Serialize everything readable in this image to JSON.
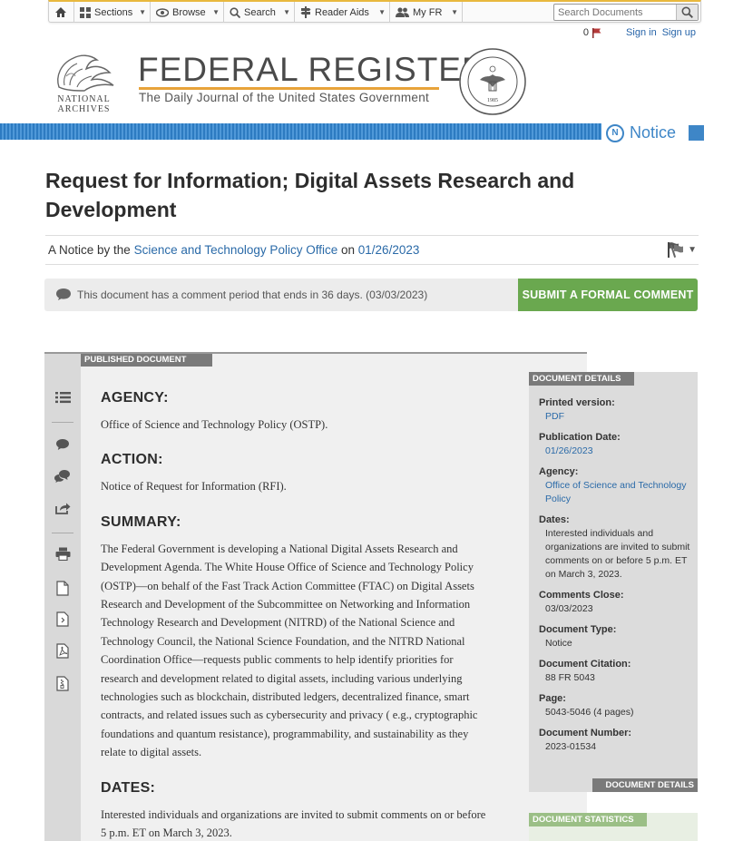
{
  "nav": {
    "home_label": "",
    "items": [
      {
        "label": "Sections"
      },
      {
        "label": "Browse"
      },
      {
        "label": "Search"
      },
      {
        "label": "Reader Aids"
      },
      {
        "label": "My FR"
      }
    ],
    "search_placeholder": "Search Documents"
  },
  "user": {
    "flag_count": "0",
    "sign_in": "Sign in",
    "sign_up": "Sign up"
  },
  "masthead": {
    "agency_logo_text_1": "NATIONAL",
    "agency_logo_text_2": "ARCHIVES",
    "title": "FEDERAL REGISTER",
    "subtitle": "The Daily Journal of the United States Government",
    "seal_text": "NATIONAL ARCHIVES AND RECORDS ADMINISTRATION",
    "seal_year": "1985"
  },
  "document_type_badge": {
    "letter": "N",
    "label": "Notice"
  },
  "document": {
    "title": "Request for Information; Digital Assets Research and Development",
    "byline_prefix": "A Notice by the",
    "agency_link": "Science and Technology Policy Office",
    "byline_on": "on",
    "date_link": "01/26/2023"
  },
  "comment": {
    "message": "This document has a comment period that ends in 36 days. (03/03/2023)",
    "button": "SUBMIT A FORMAL COMMENT"
  },
  "published": {
    "tab_label": "PUBLISHED DOCUMENT",
    "sections": [
      {
        "heading": "AGENCY:",
        "text": "Office of Science and Technology Policy (OSTP)."
      },
      {
        "heading": "ACTION:",
        "text": "Notice of Request for Information (RFI)."
      },
      {
        "heading": "SUMMARY:",
        "text": "The Federal Government is developing a National Digital Assets Research and Development Agenda. The White House Office of Science and Technology Policy (OSTP)—on behalf of the Fast Track Action Committee (FTAC) on Digital Assets Research and Development of the Subcommittee on Networking and Information Technology Research and Development (NITRD) of the National Science and Technology Council, the National Science Foundation, and the NITRD National Coordination Office—requests public comments to help identify priorities for research and development related to digital assets, including various underlying technologies such as blockchain, distributed ledgers, decentralized finance, smart contracts, and related issues such as cybersecurity and privacy ( e.g., cryptographic foundations and quantum resistance), programmability, and sustainability as they relate to digital assets."
      },
      {
        "heading": "DATES:",
        "text": "Interested individuals and organizations are invited to submit comments on or before 5 p.m. ET on March 3, 2023."
      }
    ]
  },
  "details": {
    "tab_label": "DOCUMENT DETAILS",
    "bottom_label": "DOCUMENT DETAILS",
    "printed_version_label": "Printed version:",
    "printed_version_value": "PDF",
    "publication_date_label": "Publication Date:",
    "publication_date_value": "01/26/2023",
    "agency_label": "Agency:",
    "agency_value": "Office of Science and Technology Policy",
    "dates_label": "Dates:",
    "dates_value": "Interested individuals and organizations are invited to submit comments on or before 5 p.m. ET on March 3, 2023.",
    "comments_close_label": "Comments Close:",
    "comments_close_value": "03/03/2023",
    "document_type_label": "Document Type:",
    "document_type_value": "Notice",
    "citation_label": "Document Citation:",
    "citation_value": "88 FR 5043",
    "page_label": "Page:",
    "page_value": "5043-5046 (4 pages)",
    "number_label": "Document Number:",
    "number_value": "2023-01534"
  },
  "statistics": {
    "tab_label": "DOCUMENT STATISTICS"
  },
  "colors": {
    "accent_blue": "#2a6aa8",
    "stripe_blue": "#2d7bc1",
    "comment_green": "#6aa84f",
    "gold": "#e8a33a"
  }
}
